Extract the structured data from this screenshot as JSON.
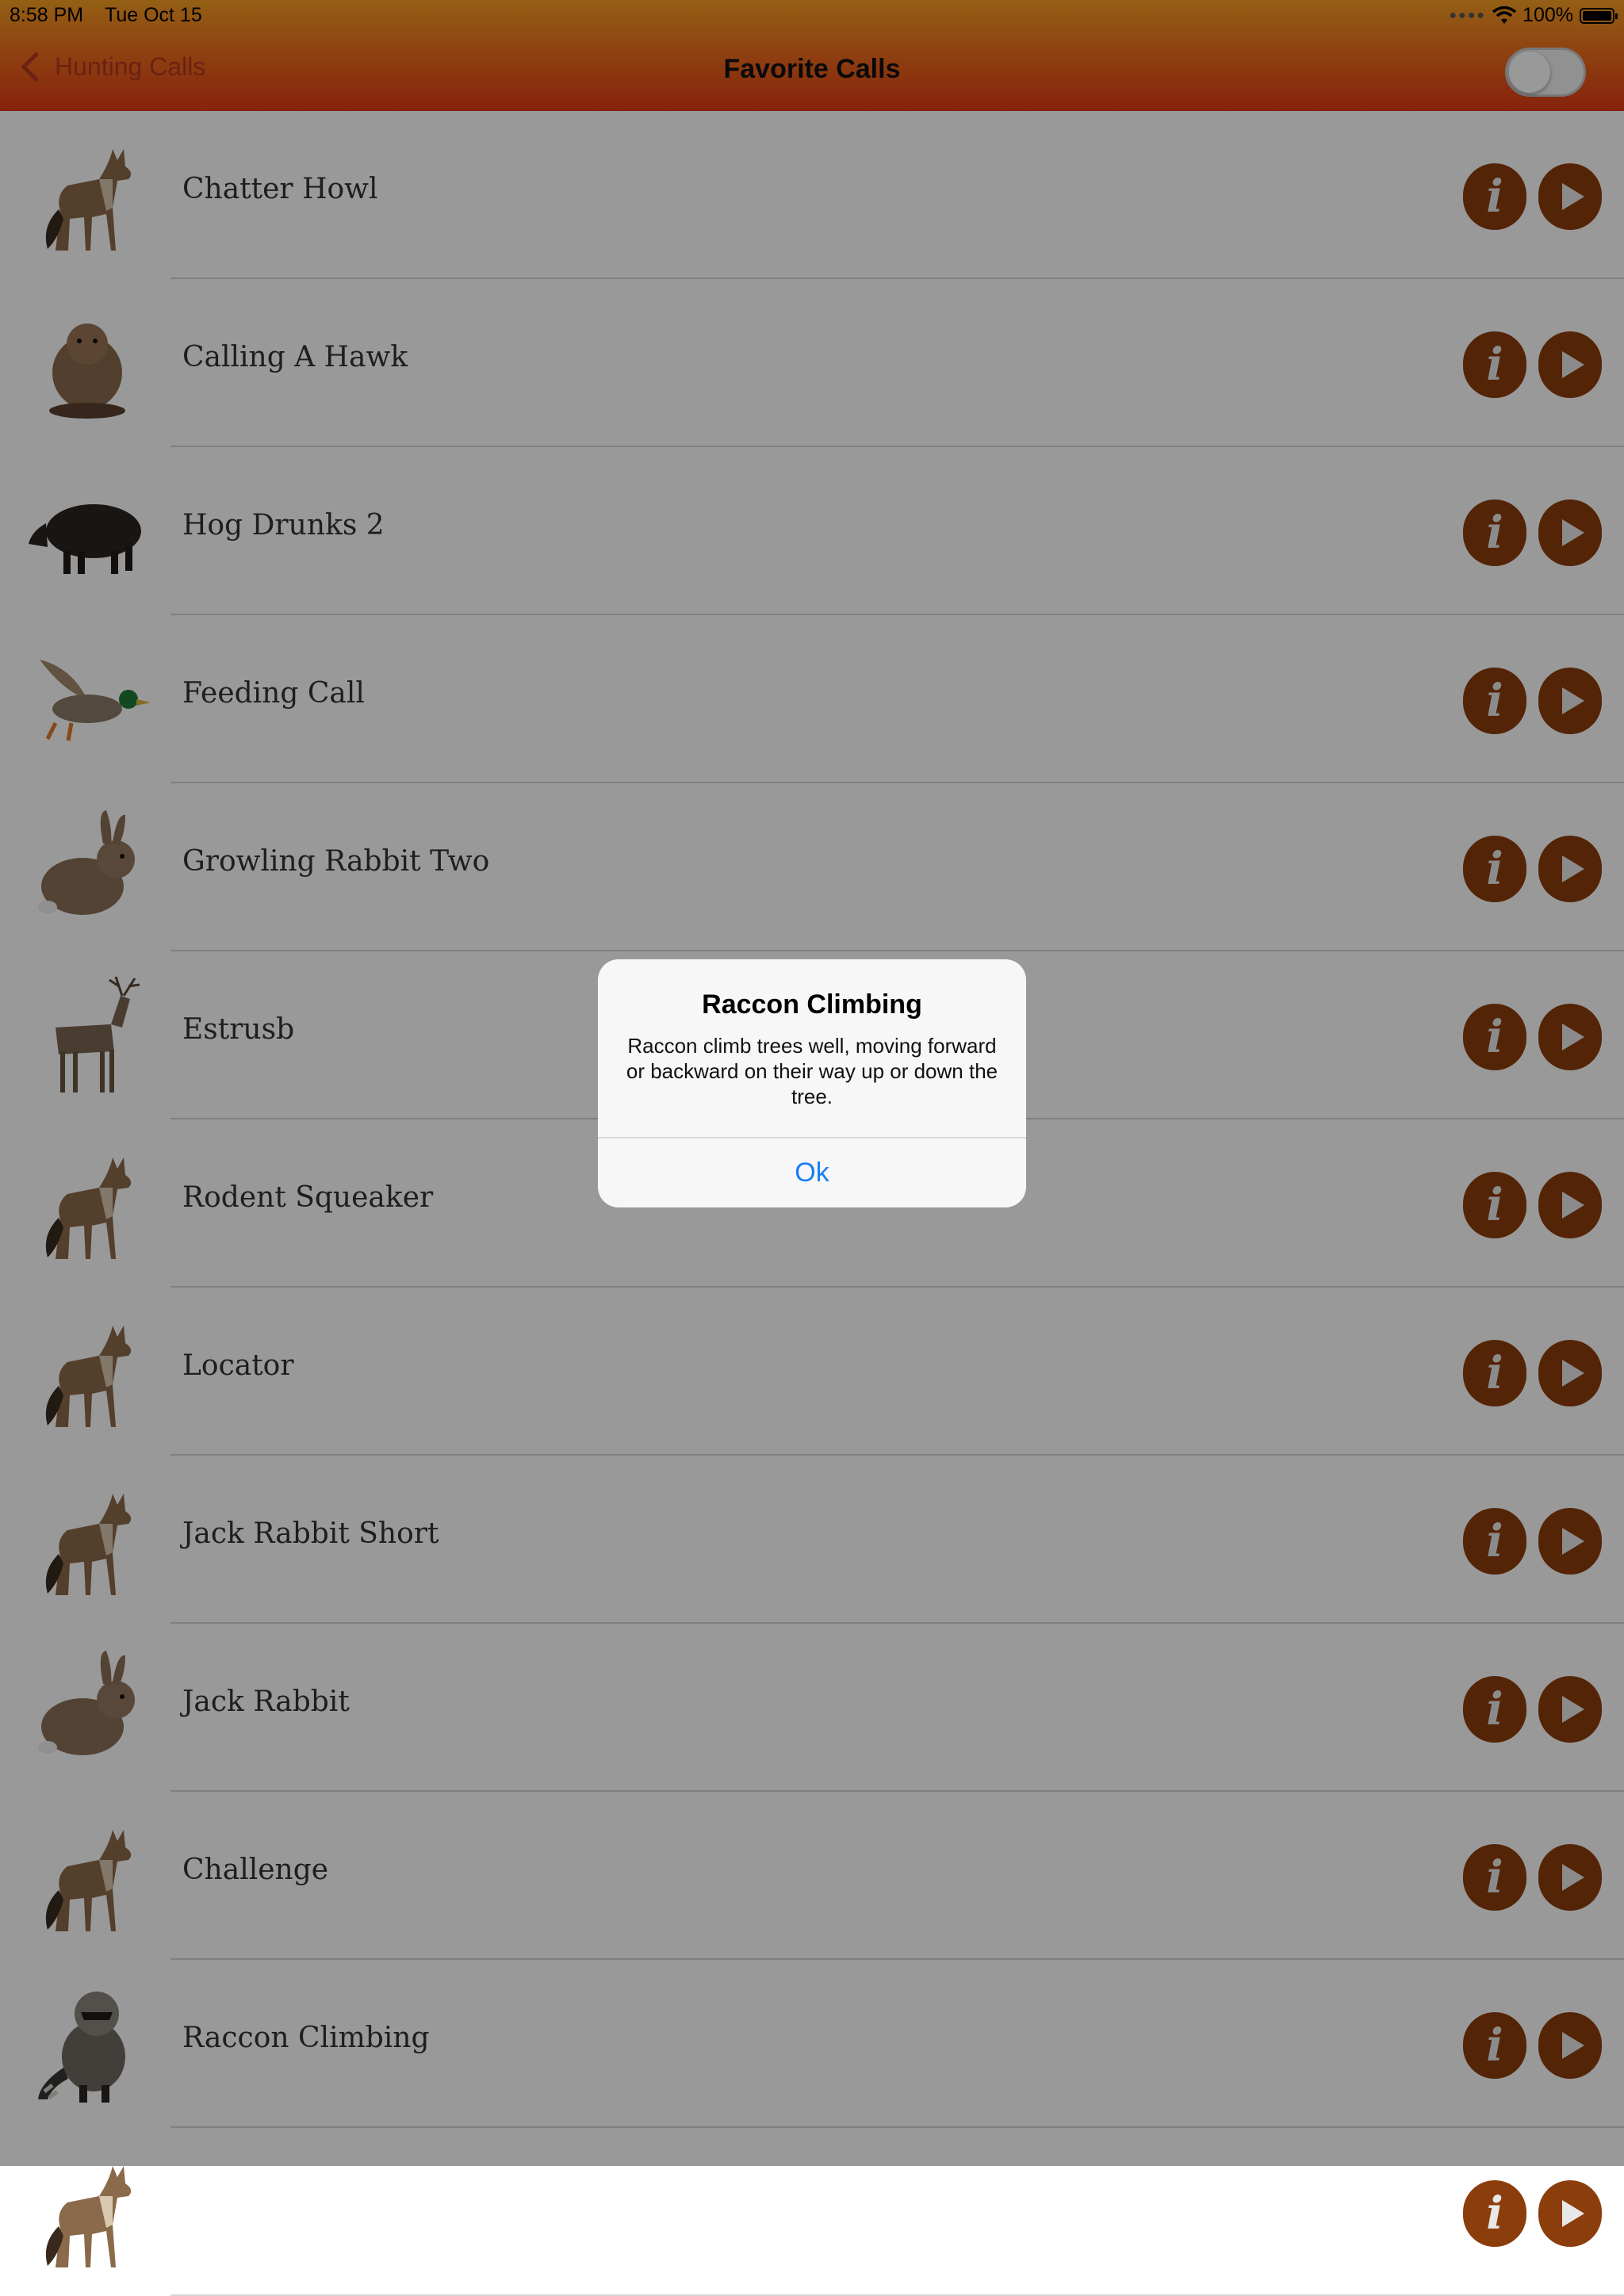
{
  "status_bar": {
    "time": "8:58 PM",
    "date": "Tue Oct 15",
    "battery": "100%"
  },
  "nav": {
    "back_label": "Hunting Calls",
    "title": "Favorite Calls",
    "toggle_on": false
  },
  "colors": {
    "header_top": "#f7a024",
    "header_bottom": "#e03b17",
    "button": "#8c3d0c",
    "alert_action": "#1a7ef2"
  },
  "calls": [
    {
      "label": "Chatter Howl",
      "animal": "coyote"
    },
    {
      "label": "Calling A Hawk",
      "animal": "beaver"
    },
    {
      "label": "Hog Drunks 2",
      "animal": "hog"
    },
    {
      "label": "Feeding Call",
      "animal": "duck"
    },
    {
      "label": "Growling Rabbit Two",
      "animal": "rabbit"
    },
    {
      "label": "Estrusb",
      "animal": "deer"
    },
    {
      "label": "Rodent Squeaker",
      "animal": "coyote"
    },
    {
      "label": "Locator",
      "animal": "coyote"
    },
    {
      "label": "Jack Rabbit Short",
      "animal": "coyote"
    },
    {
      "label": "Jack Rabbit",
      "animal": "rabbit"
    },
    {
      "label": "Challenge",
      "animal": "coyote"
    },
    {
      "label": "Raccon Climbing",
      "animal": "raccoon"
    },
    {
      "label": "",
      "animal": "coyote"
    }
  ],
  "icons": {
    "info": "i",
    "play": "play-triangle"
  },
  "alert": {
    "title": "Raccon Climbing",
    "message": "Raccon climb trees well, moving forward or backward on their way up or down the tree.",
    "ok_label": "Ok"
  }
}
